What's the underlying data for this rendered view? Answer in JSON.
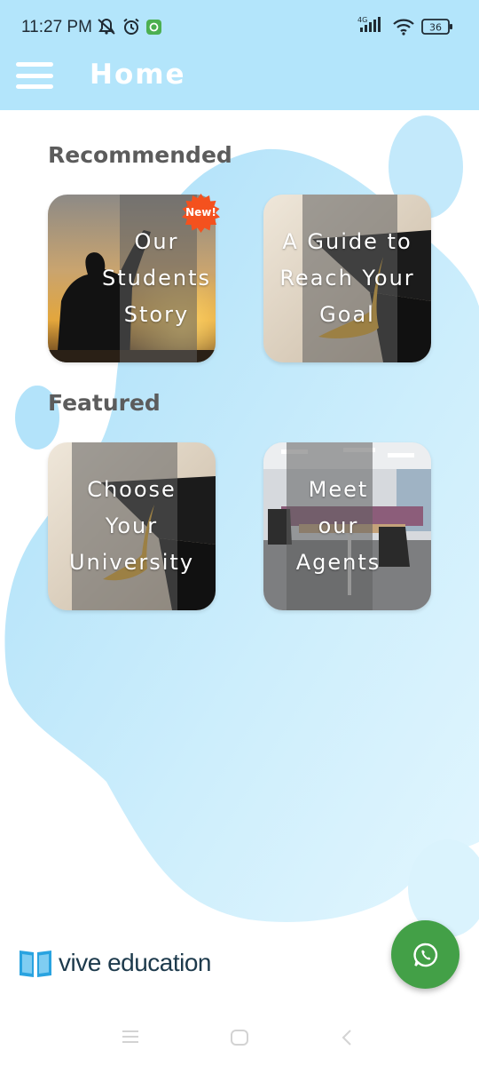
{
  "status_bar": {
    "time": "11:27 PM",
    "network": "4G",
    "battery": "36",
    "icons": [
      "mute-icon",
      "alarm-icon",
      "app-notification-icon",
      "signal-icon",
      "wifi-icon",
      "battery-icon"
    ]
  },
  "app_bar": {
    "title": "Home",
    "menu_icon": "hamburger-menu-icon"
  },
  "sections": {
    "recommended_title": "Recommended",
    "featured_title": "Featured"
  },
  "cards": {
    "students_story": {
      "label": "Our\nStudents\nStory",
      "badge": "New!"
    },
    "guide_goal": {
      "label": "A Guide to\nReach Your\nGoal"
    },
    "choose_university": {
      "label": "Choose\nYour\nUniversity"
    },
    "meet_agents": {
      "label": "Meet\nour\nAgents"
    }
  },
  "brand": {
    "name": "vive education",
    "logo_icon": "open-book-icon"
  },
  "fab": {
    "icon": "whatsapp-icon"
  },
  "nav_bar": {
    "icons": [
      "recents-icon",
      "home-icon",
      "back-icon"
    ]
  },
  "colors": {
    "app_bar": "#b3e5fb",
    "blob": "#c3e9fb",
    "section_title": "#5c5c5c",
    "badge": "#f4511e",
    "fab": "#43a047",
    "brand_icon": "#29a3e0"
  }
}
